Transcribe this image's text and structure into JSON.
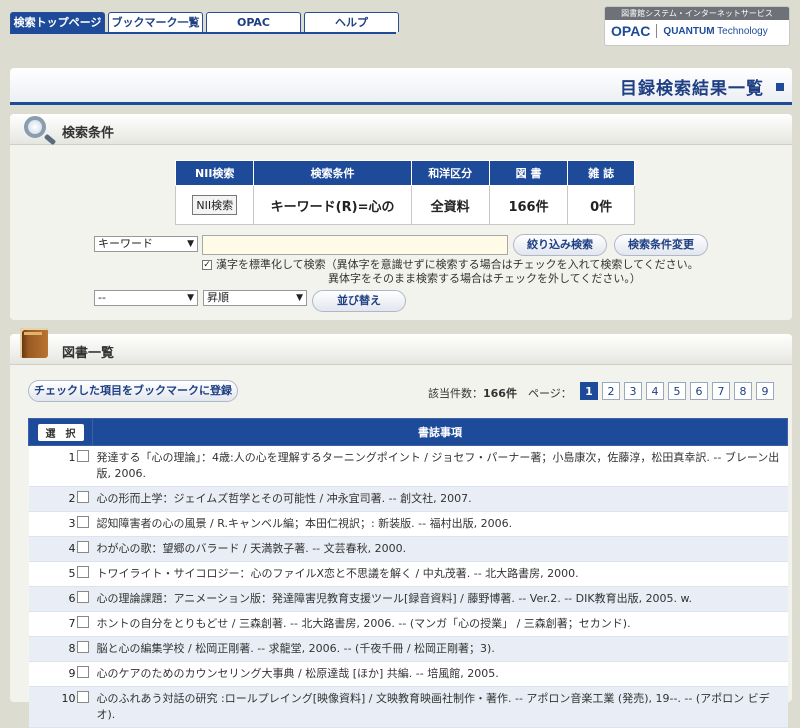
{
  "nav": {
    "tabs": [
      "検索トップページ",
      "ブックマーク一覧",
      "OPAC",
      "ヘルプ"
    ]
  },
  "brand": {
    "top_text": "図書館システム・インターネットサービス",
    "opac": "OPAC",
    "quantum": "QUANTUM",
    "technology": "Technology"
  },
  "page_title": "目録検索結果一覧",
  "search_panel": {
    "title": "検索条件",
    "summary_headers": [
      "NII検索",
      "検索条件",
      "和洋区分",
      "図 書",
      "雑 誌"
    ],
    "nii_button": "NII検索",
    "condition": "キーワード(R)=心の",
    "language": "全資料",
    "books": "166件",
    "journals": "0件",
    "field_select": "キーワード",
    "refine_button": "絞り込み検索",
    "change_button": "検索条件変更",
    "kanji_check_label": "漢字を標準化して検索（異体字を意識せずに検索する場合はチェックを入れて検索してください。",
    "kanji_check_label2": "異体字をそのまま検索する場合はチェックを外してください。）",
    "sort_select": "--",
    "order_select": "昇順",
    "sort_button": "並び替え"
  },
  "list_panel": {
    "title": "図書一覧",
    "bookmark_button": "チェックした項目をブックマークに登録",
    "hits_label": "該当件数：",
    "hits_value": "166件",
    "page_label": "ページ：",
    "pages": [
      "1",
      "2",
      "3",
      "4",
      "5",
      "6",
      "7",
      "8",
      "9"
    ],
    "current_page": "1",
    "col_select": "選　択",
    "col_biblio": "書誌事項",
    "rows": [
      {
        "num": "1",
        "text": "発達する「心の理論」：4歳:人の心を理解するターニングポイント / ジョセフ・パーナー著；小島康次，佐藤淳，松田真幸訳. -- ブレーン出版, 2006."
      },
      {
        "num": "2",
        "text": "心の形而上学：ジェイムズ哲学とその可能性 / 冲永宜司著. -- 創文社, 2007."
      },
      {
        "num": "3",
        "text": "認知障害者の心の風景 / R.キャンベル編；本田仁視訳；: 新装版. -- 福村出版, 2006."
      },
      {
        "num": "4",
        "text": "わが心の歌：望郷のバラード / 天満敦子著. -- 文芸春秋, 2000."
      },
      {
        "num": "5",
        "text": "トワイライト・サイコロジー：心のファイルX恋と不思議を解く / 中丸茂著. -- 北大路書房, 2000."
      },
      {
        "num": "6",
        "text": "心の理論課題：アニメーション版：発達障害児教育支援ツール[録音資料] / 藤野博著. -- Ver.2. -- DIK教育出版, 2005. w."
      },
      {
        "num": "7",
        "text": "ホントの自分をとりもどせ / 三森創著. -- 北大路書房, 2006. -- (マンガ「心の授業」 / 三森創著；セカンド)."
      },
      {
        "num": "8",
        "text": "脳と心の編集学校 / 松岡正剛著. -- 求龍堂, 2006. -- (千夜千冊 / 松岡正剛著；3)."
      },
      {
        "num": "9",
        "text": "心のケアのためのカウンセリング大事典 / 松原達哉 [ほか] 共編. -- 培風館, 2005."
      },
      {
        "num": "10",
        "text": "心のふれあう対話の研究 :ロールプレイング[映像資料] / 文映教育映画社制作・著作. -- アポロン音楽工業 (発売), 19--. -- (アポロン ビデオ)."
      }
    ]
  }
}
